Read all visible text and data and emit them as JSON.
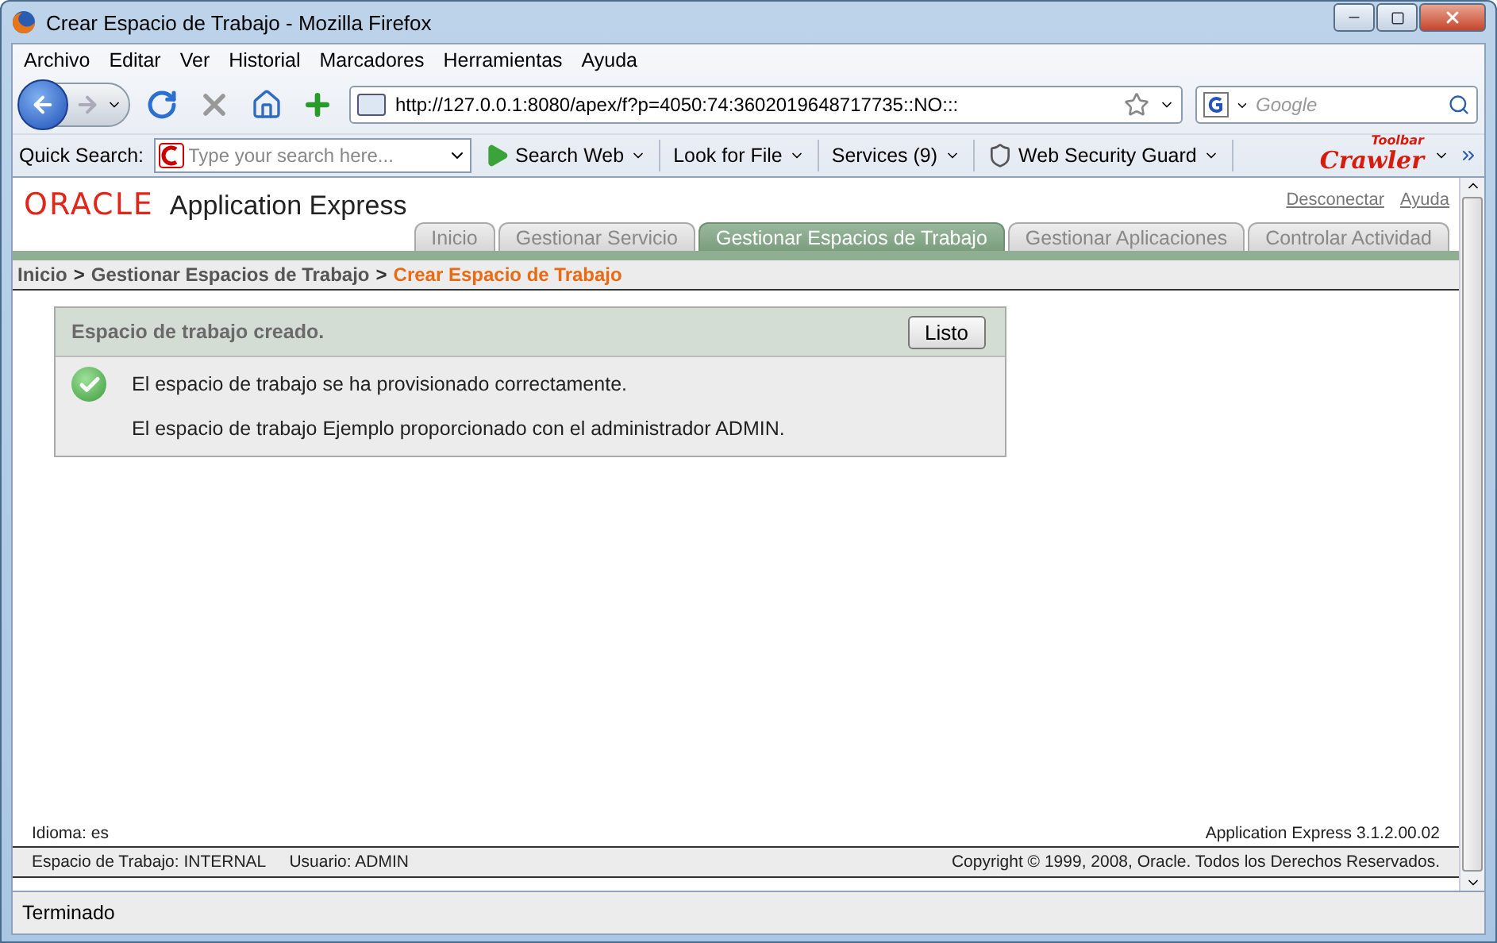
{
  "window": {
    "title": "Crear Espacio de Trabajo - Mozilla Firefox"
  },
  "menu": [
    "Archivo",
    "Editar",
    "Ver",
    "Historial",
    "Marcadores",
    "Herramientas",
    "Ayuda"
  ],
  "navbar": {
    "url": "http://127.0.0.1:8080/apex/f?p=4050:74:3602019648717735::NO:::",
    "search_placeholder": "Google"
  },
  "toolbar": {
    "label": "Quick Search:",
    "search_placeholder": "Type your search here...",
    "buttons": [
      {
        "label": "Search Web",
        "kind": "play"
      },
      {
        "label": "Look for File",
        "kind": "plain"
      },
      {
        "label": "Services (9)",
        "kind": "plain"
      },
      {
        "label": "Web Security Guard",
        "kind": "shield"
      }
    ],
    "logo": "Crawler",
    "logo_tag": "Toolbar"
  },
  "page": {
    "brand": "ORACLE",
    "product": "Application Express",
    "header_links": [
      "Desconectar",
      "Ayuda"
    ],
    "tabs": [
      {
        "label": "Inicio",
        "selected": false
      },
      {
        "label": "Gestionar Servicio",
        "selected": false
      },
      {
        "label": "Gestionar Espacios de Trabajo",
        "selected": true
      },
      {
        "label": "Gestionar Aplicaciones",
        "selected": false
      },
      {
        "label": "Controlar Actividad",
        "selected": false
      }
    ],
    "breadcrumb": [
      {
        "label": "Inicio",
        "current": false
      },
      {
        "label": "Gestionar Espacios de Trabajo",
        "current": false
      },
      {
        "label": "Crear Espacio de Trabajo",
        "current": true
      }
    ],
    "breadcrumb_separator": ">",
    "message": {
      "title": "Espacio de trabajo creado.",
      "button": "Listo",
      "lines": [
        "El espacio de trabajo se ha provisionado correctamente.",
        "El espacio de trabajo Ejemplo proporcionado con el administrador ADMIN."
      ]
    },
    "footer": {
      "language": "Idioma: es",
      "version": "Application Express 3.1.2.00.02",
      "workspace": "Espacio de Trabajo: INTERNAL",
      "user": "Usuario: ADMIN",
      "copyright": "Copyright © 1999, 2008, Oracle. Todos los Derechos Reservados."
    }
  },
  "status_bar": "Terminado"
}
